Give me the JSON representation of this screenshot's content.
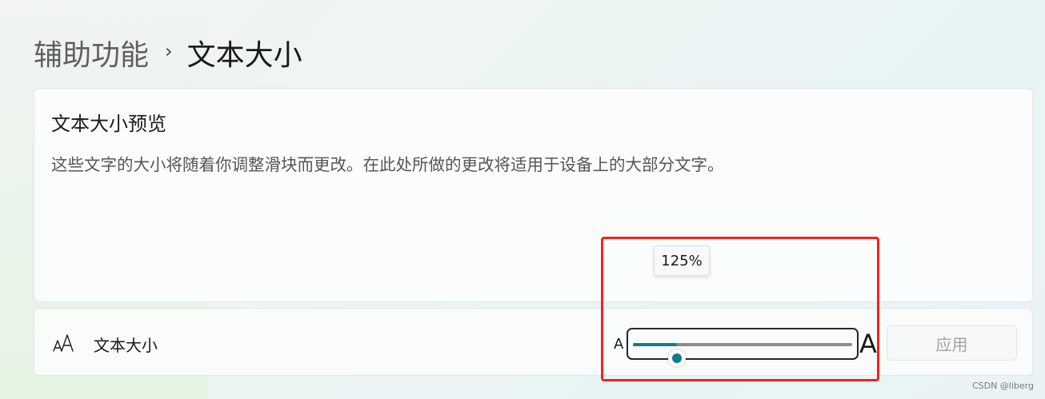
{
  "breadcrumb": {
    "parent": "辅助功能",
    "separator": "›",
    "current": "文本大小"
  },
  "preview": {
    "title": "文本大小预览",
    "text": "这些文字的大小将随着你调整滑块而更改。在此处所做的更改将适用于设备上的大部分文字。"
  },
  "setting": {
    "icon": "text-size-icon",
    "label": "文本大小",
    "slider": {
      "min_label": "A",
      "max_label": "A",
      "value_text": "125%",
      "value": 125,
      "min": 100,
      "max": 225
    },
    "apply_label": "应用"
  },
  "colors": {
    "accent": "#0f7d8b",
    "highlight": "#f0241c"
  },
  "watermark": "CSDN @liberg"
}
